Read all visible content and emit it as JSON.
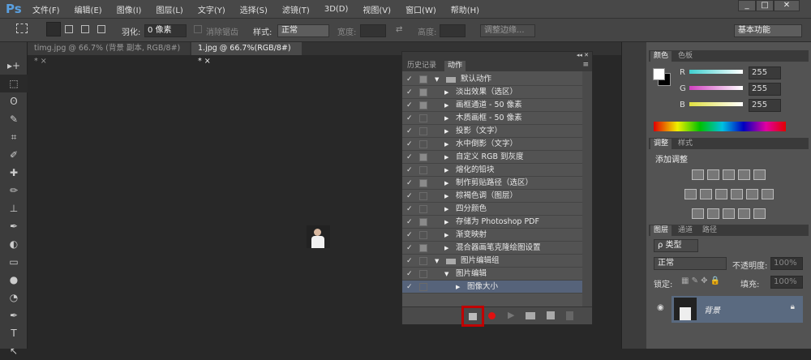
{
  "app": {
    "logo": "Ps"
  },
  "menu": [
    "文件(F)",
    "编辑(E)",
    "图像(I)",
    "图层(L)",
    "文字(Y)",
    "选择(S)",
    "滤镜(T)",
    "3D(D)",
    "视图(V)",
    "窗口(W)",
    "帮助(H)"
  ],
  "window_controls": {
    "minimize": "_",
    "maximize": "□",
    "close": "✕"
  },
  "options": {
    "feather_label": "羽化:",
    "feather_value": "0 像素",
    "antialias_label": "消除锯齿",
    "style_label": "样式:",
    "style_value": "正常",
    "width_label": "宽度:",
    "height_label": "高度:",
    "refine_edge": "调整边缘...",
    "workspace": "基本功能"
  },
  "tabs": [
    {
      "label": "timg.jpg @ 66.7% (背景 副本, RGB/8#) *",
      "close": "×"
    },
    {
      "label": "1.jpg @ 66.7%(RGB/8#) *",
      "close": "×"
    }
  ],
  "tools": [
    "▸+",
    "⬚",
    "ʘ",
    "✎",
    "⌗",
    "✐",
    "✚",
    "✏",
    "⊥",
    "✒",
    "◐",
    "▭",
    "●",
    "◔",
    "✒",
    "T",
    "↖"
  ],
  "actions_panel": {
    "tabs": [
      "历史记录",
      "动作"
    ],
    "rows": [
      {
        "label": "默认动作",
        "level": 0,
        "type": "set",
        "expanded": true,
        "dialog": true
      },
      {
        "label": "淡出效果（选区）",
        "level": 1,
        "dialog": true
      },
      {
        "label": "画框通道 - 50 像素",
        "level": 1,
        "dialog": true
      },
      {
        "label": "木质画框 - 50 像素",
        "level": 1,
        "dialog": false
      },
      {
        "label": "投影（文字）",
        "level": 1,
        "dialog": false
      },
      {
        "label": "水中倒影（文字）",
        "level": 1,
        "dialog": false
      },
      {
        "label": "自定义 RGB 到灰度",
        "level": 1,
        "dialog": true
      },
      {
        "label": "熔化的铅块",
        "level": 1,
        "dialog": false
      },
      {
        "label": "制作剪贴路径（选区）",
        "level": 1,
        "dialog": true
      },
      {
        "label": "棕褐色调（图层）",
        "level": 1,
        "dialog": false
      },
      {
        "label": "四分颜色",
        "level": 1,
        "dialog": false
      },
      {
        "label": "存储为 Photoshop PDF",
        "level": 1,
        "dialog": true
      },
      {
        "label": "渐变映射",
        "level": 1,
        "dialog": false
      },
      {
        "label": "混合器画笔克隆绘图设置",
        "level": 1,
        "dialog": true
      },
      {
        "label": "图片编辑组",
        "level": 0,
        "type": "set",
        "expanded": true,
        "dialog": false
      },
      {
        "label": "图片编辑",
        "level": 1,
        "expanded": true,
        "dialog": false
      },
      {
        "label": "图像大小",
        "level": 2,
        "selected": true,
        "dialog": false
      }
    ],
    "buttons": [
      "stop",
      "record",
      "play",
      "new-set",
      "new-action",
      "delete"
    ]
  },
  "color_panel": {
    "tabs": [
      "颜色",
      "色板"
    ],
    "channels": [
      {
        "name": "R",
        "value": "255",
        "color": "#40d0d0"
      },
      {
        "name": "G",
        "value": "255",
        "color": "#d040c0"
      },
      {
        "name": "B",
        "value": "255",
        "color": "#e0e040"
      }
    ]
  },
  "adjust_panel": {
    "tabs": [
      "调整",
      "样式"
    ],
    "title": "添加调整"
  },
  "layers_panel": {
    "tabs": [
      "图层",
      "通道",
      "路径"
    ],
    "filter": "ρ 类型",
    "blend": "正常",
    "opacity_label": "不透明度:",
    "opacity": "100%",
    "lock_label": "锁定:",
    "fill_label": "填充:",
    "fill": "100%",
    "layer_name": "背景"
  }
}
